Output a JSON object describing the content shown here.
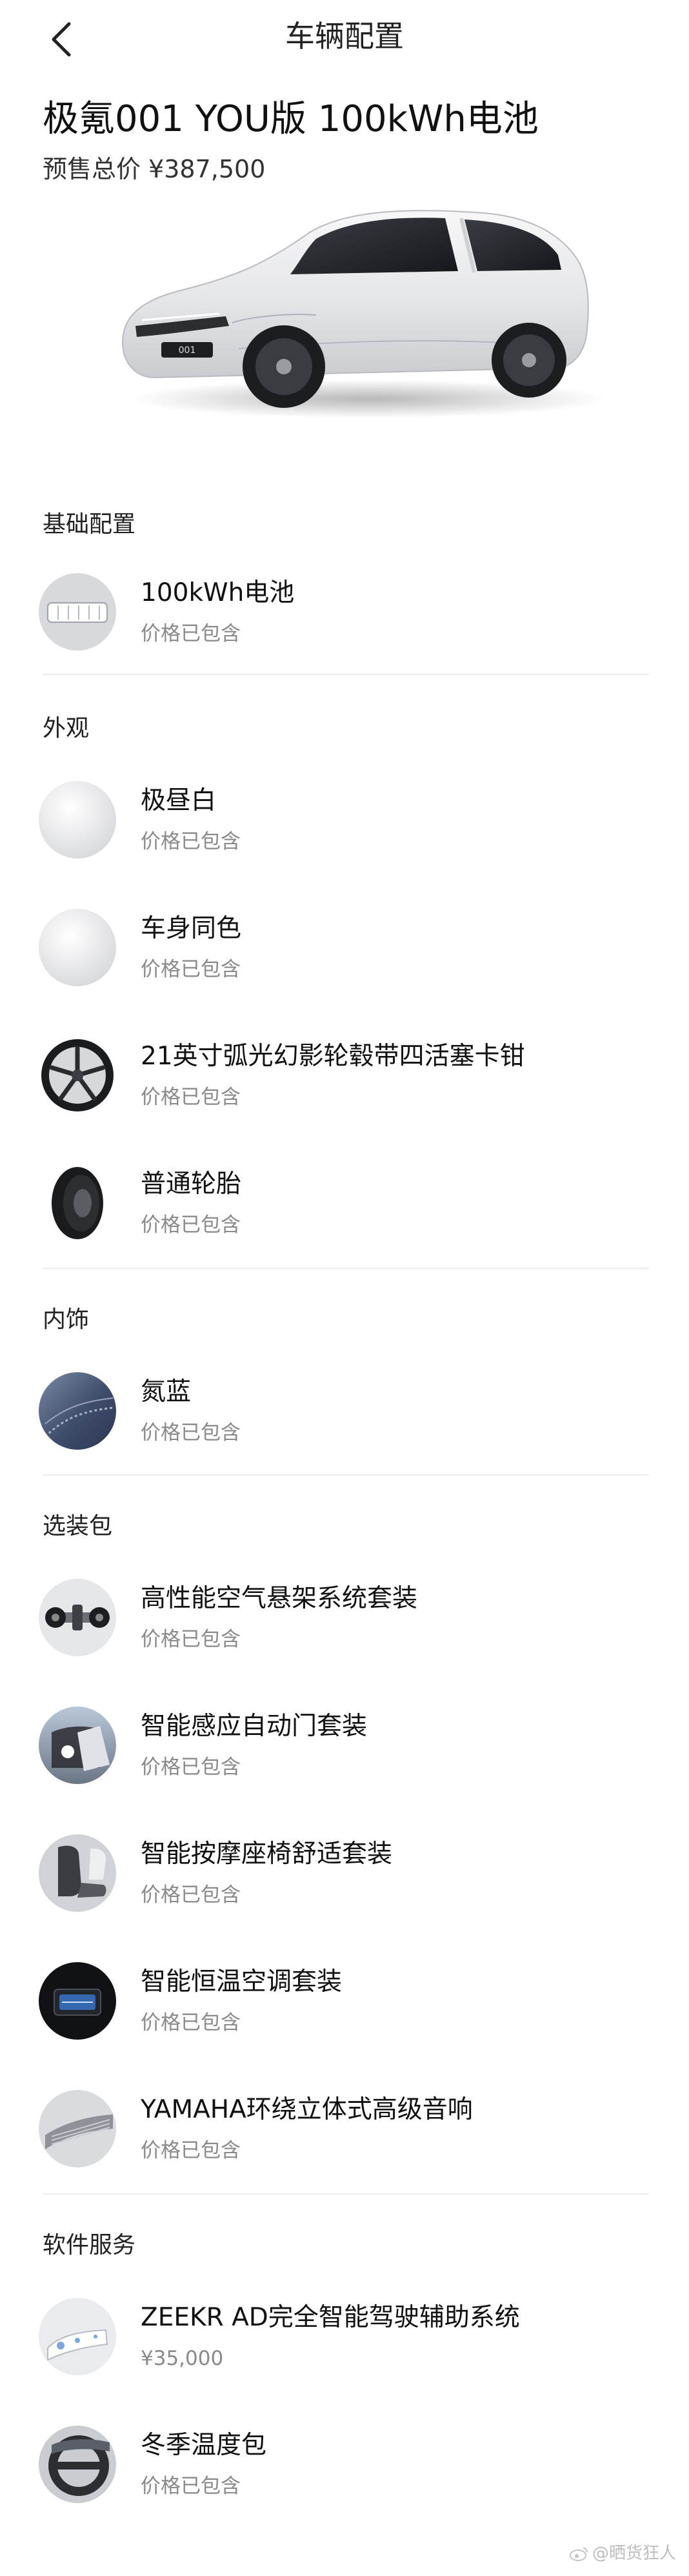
{
  "nav": {
    "title": "车辆配置",
    "back_icon": "chevron-left-icon"
  },
  "vehicle": {
    "title": "极氪001 YOU版 100kWh电池",
    "price": "预售总价 ¥387,500",
    "color": "#e8e8ea"
  },
  "sections": {
    "basic": {
      "title": "基础配置",
      "items": [
        {
          "name": "100kWh电池",
          "price": "价格已包含",
          "icon": "battery-pack-icon"
        }
      ]
    },
    "exterior": {
      "title": "外观",
      "items": [
        {
          "name": "极昼白",
          "price": "价格已包含",
          "icon": "paint-white-swatch-icon"
        },
        {
          "name": "车身同色",
          "price": "价格已包含",
          "icon": "body-color-swatch-icon"
        },
        {
          "name": "21英寸弧光幻影轮毂带四活塞卡钳",
          "price": "价格已包含",
          "icon": "wheel-rim-icon"
        },
        {
          "name": "普通轮胎",
          "price": "价格已包含",
          "icon": "tire-icon"
        }
      ]
    },
    "interior": {
      "title": "内饰",
      "items": [
        {
          "name": "氮蓝",
          "price": "价格已包含",
          "icon": "interior-blue-swatch-icon"
        }
      ]
    },
    "packages": {
      "title": "选装包",
      "items": [
        {
          "name": "高性能空气悬架系统套装",
          "price": "价格已包含",
          "icon": "air-suspension-icon"
        },
        {
          "name": "智能感应自动门套装",
          "price": "价格已包含",
          "icon": "automatic-door-icon"
        },
        {
          "name": "智能按摩座椅舒适套装",
          "price": "价格已包含",
          "icon": "massage-seat-icon"
        },
        {
          "name": "智能恒温空调套装",
          "price": "价格已包含",
          "icon": "climate-control-icon"
        },
        {
          "name": "YAMAHA环绕立体式高级音响",
          "price": "价格已包含",
          "icon": "speaker-icon"
        }
      ]
    },
    "software": {
      "title": "软件服务",
      "items": [
        {
          "name": "ZEEKR AD完全智能驾驶辅助系统",
          "price": "¥35,000",
          "icon": "driving-assist-icon"
        },
        {
          "name": "冬季温度包",
          "price": "价格已包含",
          "icon": "winter-package-icon"
        }
      ]
    }
  },
  "watermark": "@晒货狂人"
}
